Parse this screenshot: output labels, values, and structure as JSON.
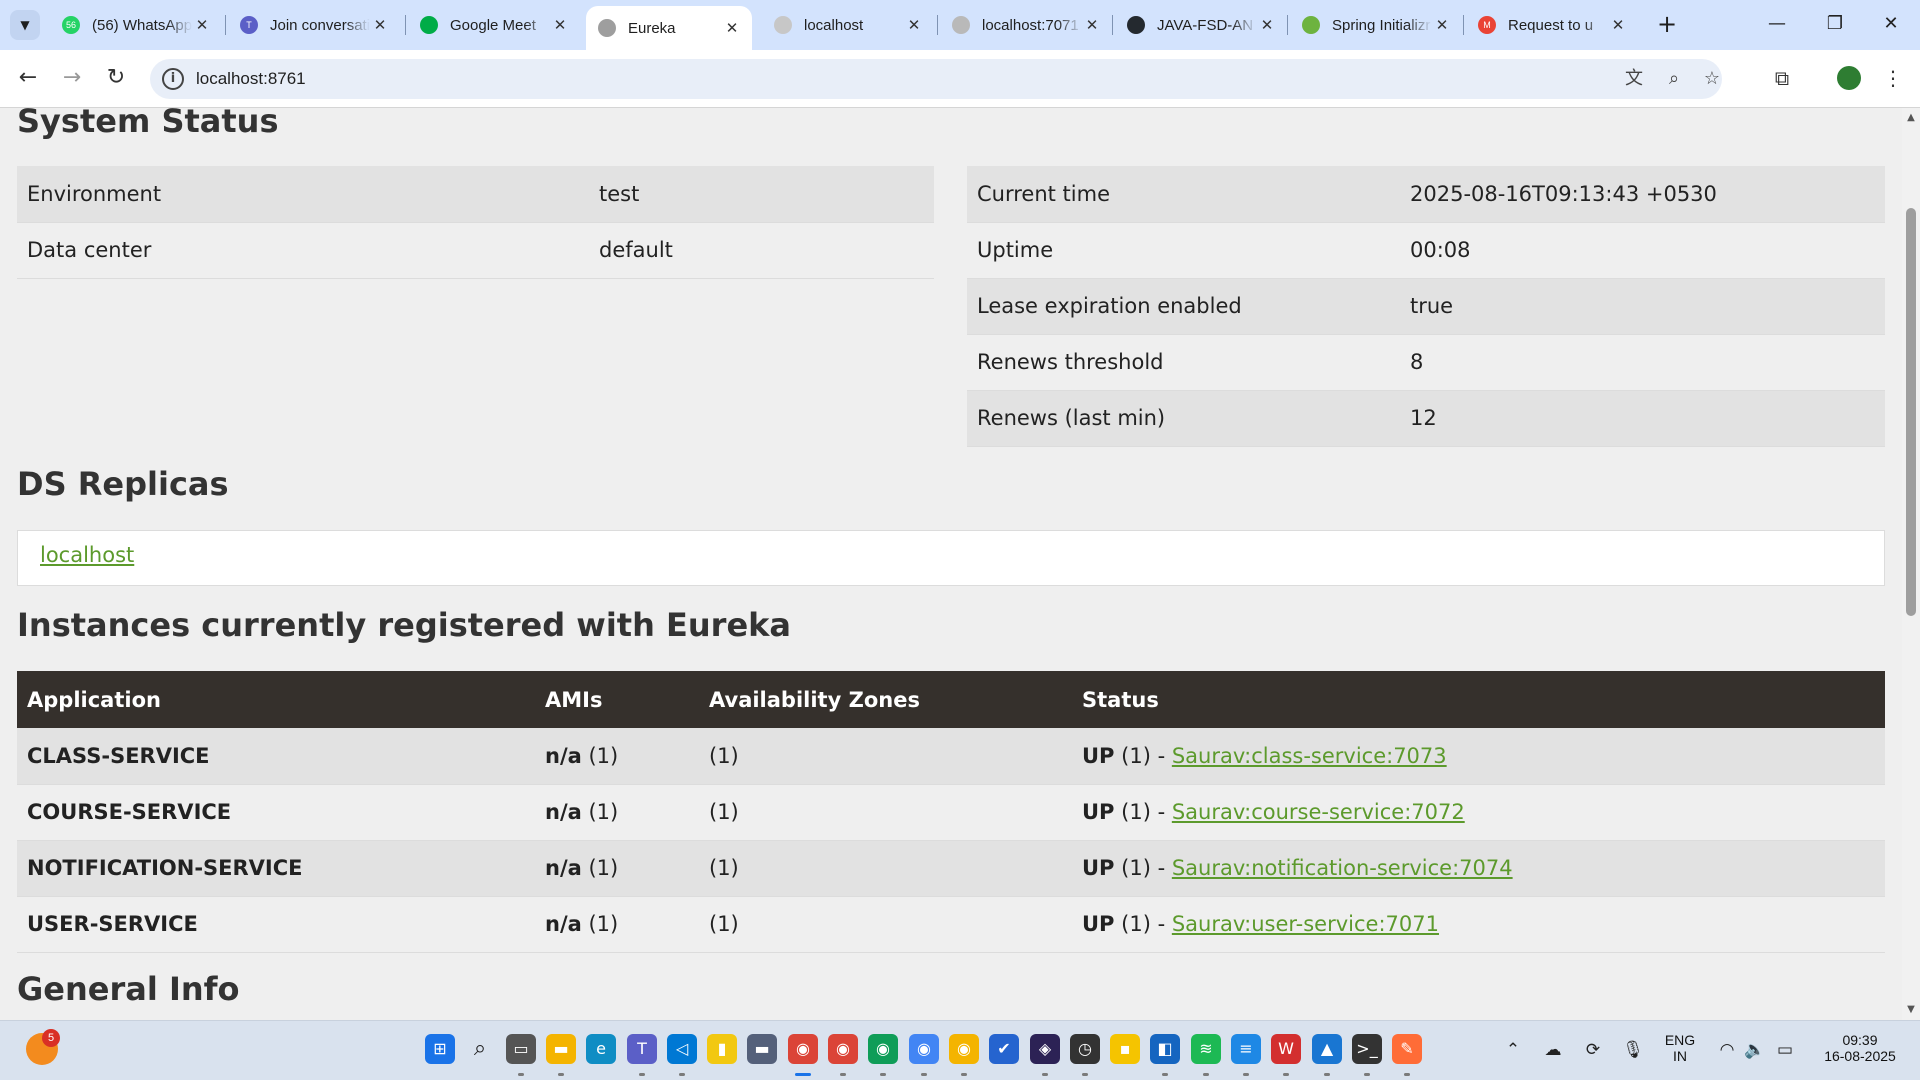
{
  "browser": {
    "tabs": [
      {
        "title": "(56) WhatsApp",
        "favicon_color": "#25d366",
        "favicon_text": "56"
      },
      {
        "title": "Join conversation",
        "favicon_color": "#5b5fc7",
        "favicon_text": "T"
      },
      {
        "title": "Google Meet",
        "favicon_color": "#00ac47",
        "favicon_text": ""
      },
      {
        "title": "Eureka",
        "favicon_color": "#9e9e9e",
        "favicon_text": ""
      },
      {
        "title": "localhost",
        "favicon_color": "#c7c7c7",
        "favicon_text": ""
      },
      {
        "title": "localhost:7071",
        "favicon_color": "#b9b9b9",
        "favicon_text": ""
      },
      {
        "title": "JAVA-FSD-AN",
        "favicon_color": "#24292f",
        "favicon_text": ""
      },
      {
        "title": "Spring Initializr",
        "favicon_color": "#6db33f",
        "favicon_text": ""
      },
      {
        "title": "Request to u",
        "favicon_color": "#ea4335",
        "favicon_text": "M"
      }
    ],
    "active_tab_index": 3,
    "address": "localhost:8761"
  },
  "system_status": {
    "heading": "System Status",
    "left": [
      {
        "label": "Environment",
        "value": "test"
      },
      {
        "label": "Data center",
        "value": "default"
      }
    ],
    "right": [
      {
        "label": "Current time",
        "value": "2025-08-16T09:13:43 +0530"
      },
      {
        "label": "Uptime",
        "value": "00:08"
      },
      {
        "label": "Lease expiration enabled",
        "value": "true"
      },
      {
        "label": "Renews threshold",
        "value": "8"
      },
      {
        "label": "Renews (last min)",
        "value": "12"
      }
    ]
  },
  "replicas": {
    "heading": "DS Replicas",
    "link": "localhost"
  },
  "instances": {
    "heading": "Instances currently registered with Eureka",
    "columns": [
      "Application",
      "AMIs",
      "Availability Zones",
      "Status"
    ],
    "rows": [
      {
        "app": "CLASS-SERVICE",
        "ami": "n/a",
        "ami_count": "(1)",
        "zones": "(1)",
        "status": "UP",
        "status_count": "(1) -",
        "instance": "Saurav:class-service:7073"
      },
      {
        "app": "COURSE-SERVICE",
        "ami": "n/a",
        "ami_count": "(1)",
        "zones": "(1)",
        "status": "UP",
        "status_count": "(1) -",
        "instance": "Saurav:course-service:7072"
      },
      {
        "app": "NOTIFICATION-SERVICE",
        "ami": "n/a",
        "ami_count": "(1)",
        "zones": "(1)",
        "status": "UP",
        "status_count": "(1) -",
        "instance": "Saurav:notification-service:7074"
      },
      {
        "app": "USER-SERVICE",
        "ami": "n/a",
        "ami_count": "(1)",
        "zones": "(1)",
        "status": "UP",
        "status_count": "(1) -",
        "instance": "Saurav:user-service:7071"
      }
    ]
  },
  "general_info": {
    "heading": "General Info"
  },
  "taskbar": {
    "notification_badge": "5",
    "language": "ENG",
    "region": "IN",
    "time": "09:39",
    "date": "16-08-2025",
    "apps": [
      {
        "name": "windows-start",
        "color": "#1a73e8",
        "glyph": "⊞"
      },
      {
        "name": "search",
        "color": "#d9e2ee",
        "glyph": "⌕"
      },
      {
        "name": "task-view",
        "color": "#555555",
        "glyph": "▭"
      },
      {
        "name": "file-explorer",
        "color": "#f4b400",
        "glyph": "▬"
      },
      {
        "name": "edge",
        "color": "#0f8dc4",
        "glyph": "e"
      },
      {
        "name": "teams",
        "color": "#5b5fc7",
        "glyph": "T"
      },
      {
        "name": "vscode",
        "color": "#0078d4",
        "glyph": "◁"
      },
      {
        "name": "power-bi",
        "color": "#f2c811",
        "glyph": "▮"
      },
      {
        "name": "mysql-workbench",
        "color": "#54607a",
        "glyph": "▬"
      },
      {
        "name": "chrome",
        "color": "#db4437",
        "glyph": "◉"
      },
      {
        "name": "chrome-profile-2",
        "color": "#db4437",
        "glyph": "◉"
      },
      {
        "name": "chrome-profile-3",
        "color": "#0f9d58",
        "glyph": "◉"
      },
      {
        "name": "chrome-profile-4",
        "color": "#4285f4",
        "glyph": "◉"
      },
      {
        "name": "chrome-profile-5",
        "color": "#f4b400",
        "glyph": "◉"
      },
      {
        "name": "todo",
        "color": "#2564cf",
        "glyph": "✔"
      },
      {
        "name": "eclipse",
        "color": "#2c2255",
        "glyph": "◈"
      },
      {
        "name": "clock-app",
        "color": "#333333",
        "glyph": "◷"
      },
      {
        "name": "sticky-notes",
        "color": "#f5c400",
        "glyph": "▪"
      },
      {
        "name": "remote-desktop",
        "color": "#1565c0",
        "glyph": "◧"
      },
      {
        "name": "spotify",
        "color": "#1db954",
        "glyph": "≋"
      },
      {
        "name": "notepad",
        "color": "#1e88e5",
        "glyph": "≡"
      },
      {
        "name": "wps-office",
        "color": "#d32f2f",
        "glyph": "W"
      },
      {
        "name": "photos",
        "color": "#1976d2",
        "glyph": "▲"
      },
      {
        "name": "terminal",
        "color": "#333333",
        "glyph": ">_"
      },
      {
        "name": "postman",
        "color": "#ff6c37",
        "glyph": "✎"
      }
    ]
  }
}
